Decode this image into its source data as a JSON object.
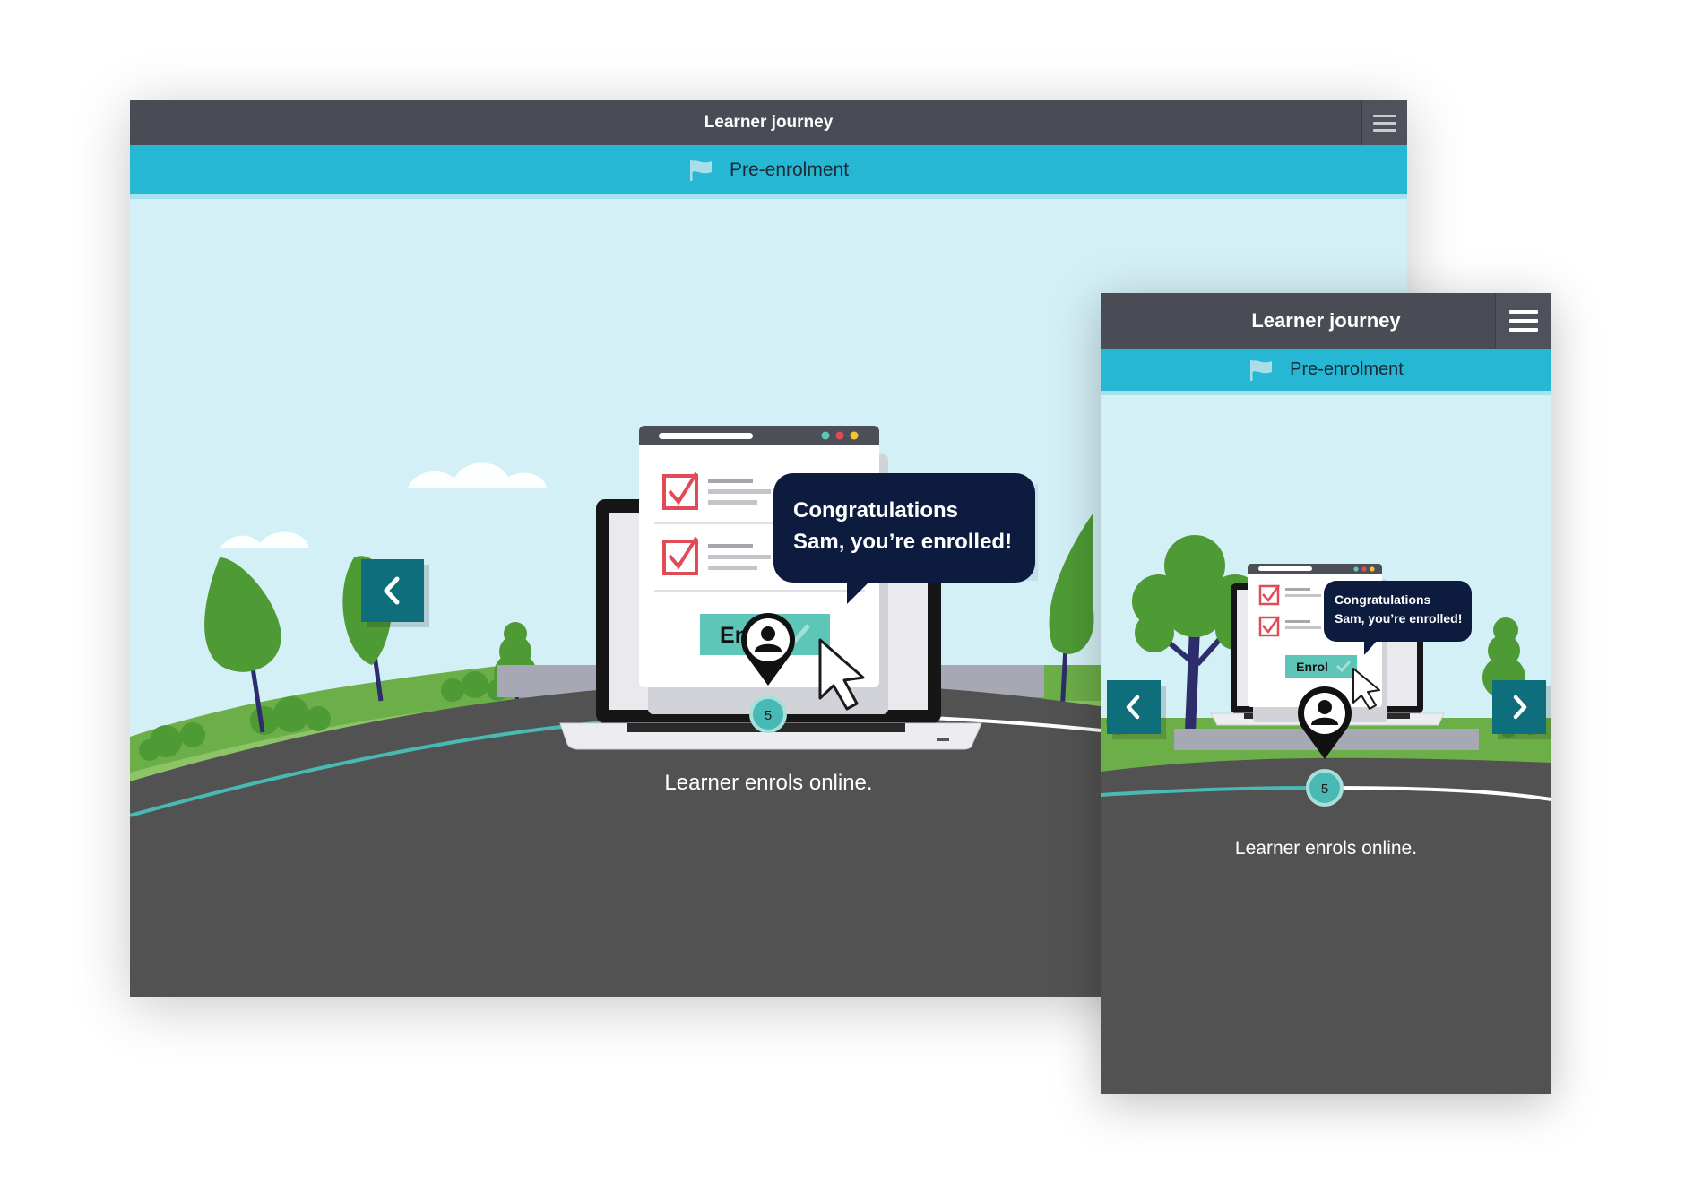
{
  "app": {
    "title": "Learner journey"
  },
  "stage": {
    "label": "Pre-enrolment"
  },
  "step": {
    "number": "5",
    "caption": "Learner enrols online.",
    "bubble_line1": "Congratulations",
    "bubble_line2": "Sam, you’re enrolled!",
    "button_label": "Enrol",
    "progress": 0.5
  },
  "icons": {
    "menu": "hamburger-menu-icon",
    "stage": "flag-icon",
    "prev": "chevron-left-icon",
    "next": "chevron-right-icon",
    "learner": "person-pin-icon",
    "cursor": "mouse-pointer-icon"
  },
  "colors": {
    "topbar": "#494c54",
    "stage_bar": "#25b7d3",
    "sky": "#d3f0f6",
    "road": "#525252",
    "path_progress": "#49b9b4",
    "nav_button": "#0e6e7c",
    "bubble": "#0d1b3e",
    "enrol_button": "#5ec6b9",
    "check": "#e04b57"
  }
}
